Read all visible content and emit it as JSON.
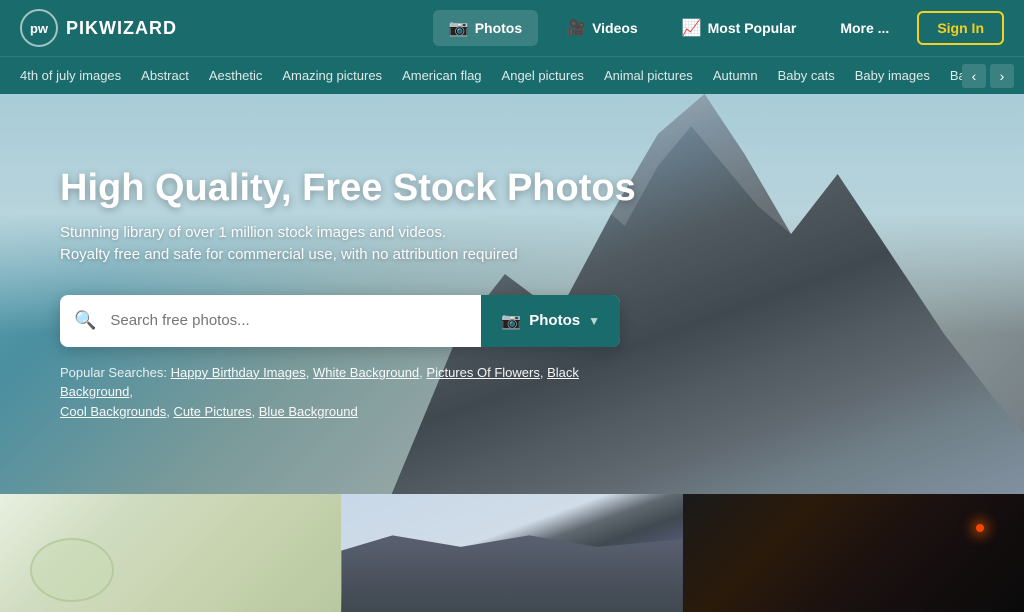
{
  "logo": {
    "initials": "pw",
    "name": "PIKWIZARD"
  },
  "navbar": {
    "photos_label": "Photos",
    "videos_label": "Videos",
    "most_popular_label": "Most Popular",
    "more_label": "More ...",
    "signin_label": "Sign In"
  },
  "categories": {
    "items": [
      "4th of july images",
      "Abstract",
      "Aesthetic",
      "Amazing pictures",
      "American flag",
      "Angel pictures",
      "Animal pictures",
      "Autumn",
      "Baby cats",
      "Baby images",
      "Backgrour"
    ]
  },
  "hero": {
    "title": "High Quality, Free Stock Photos",
    "subtitle_line1": "Stunning library of over 1 million stock images and videos.",
    "subtitle_line2": "Royalty free and safe for commercial use, with no attribution required",
    "search_placeholder": "Search free photos...",
    "search_btn_label": "Photos",
    "popular_label": "Popular Searches:",
    "popular_items": [
      "Happy Birthday Images",
      "White Background",
      "Pictures Of Flowers",
      "Black Background",
      "Cool Backgrounds",
      "Cute Pictures",
      "Blue Background"
    ]
  }
}
